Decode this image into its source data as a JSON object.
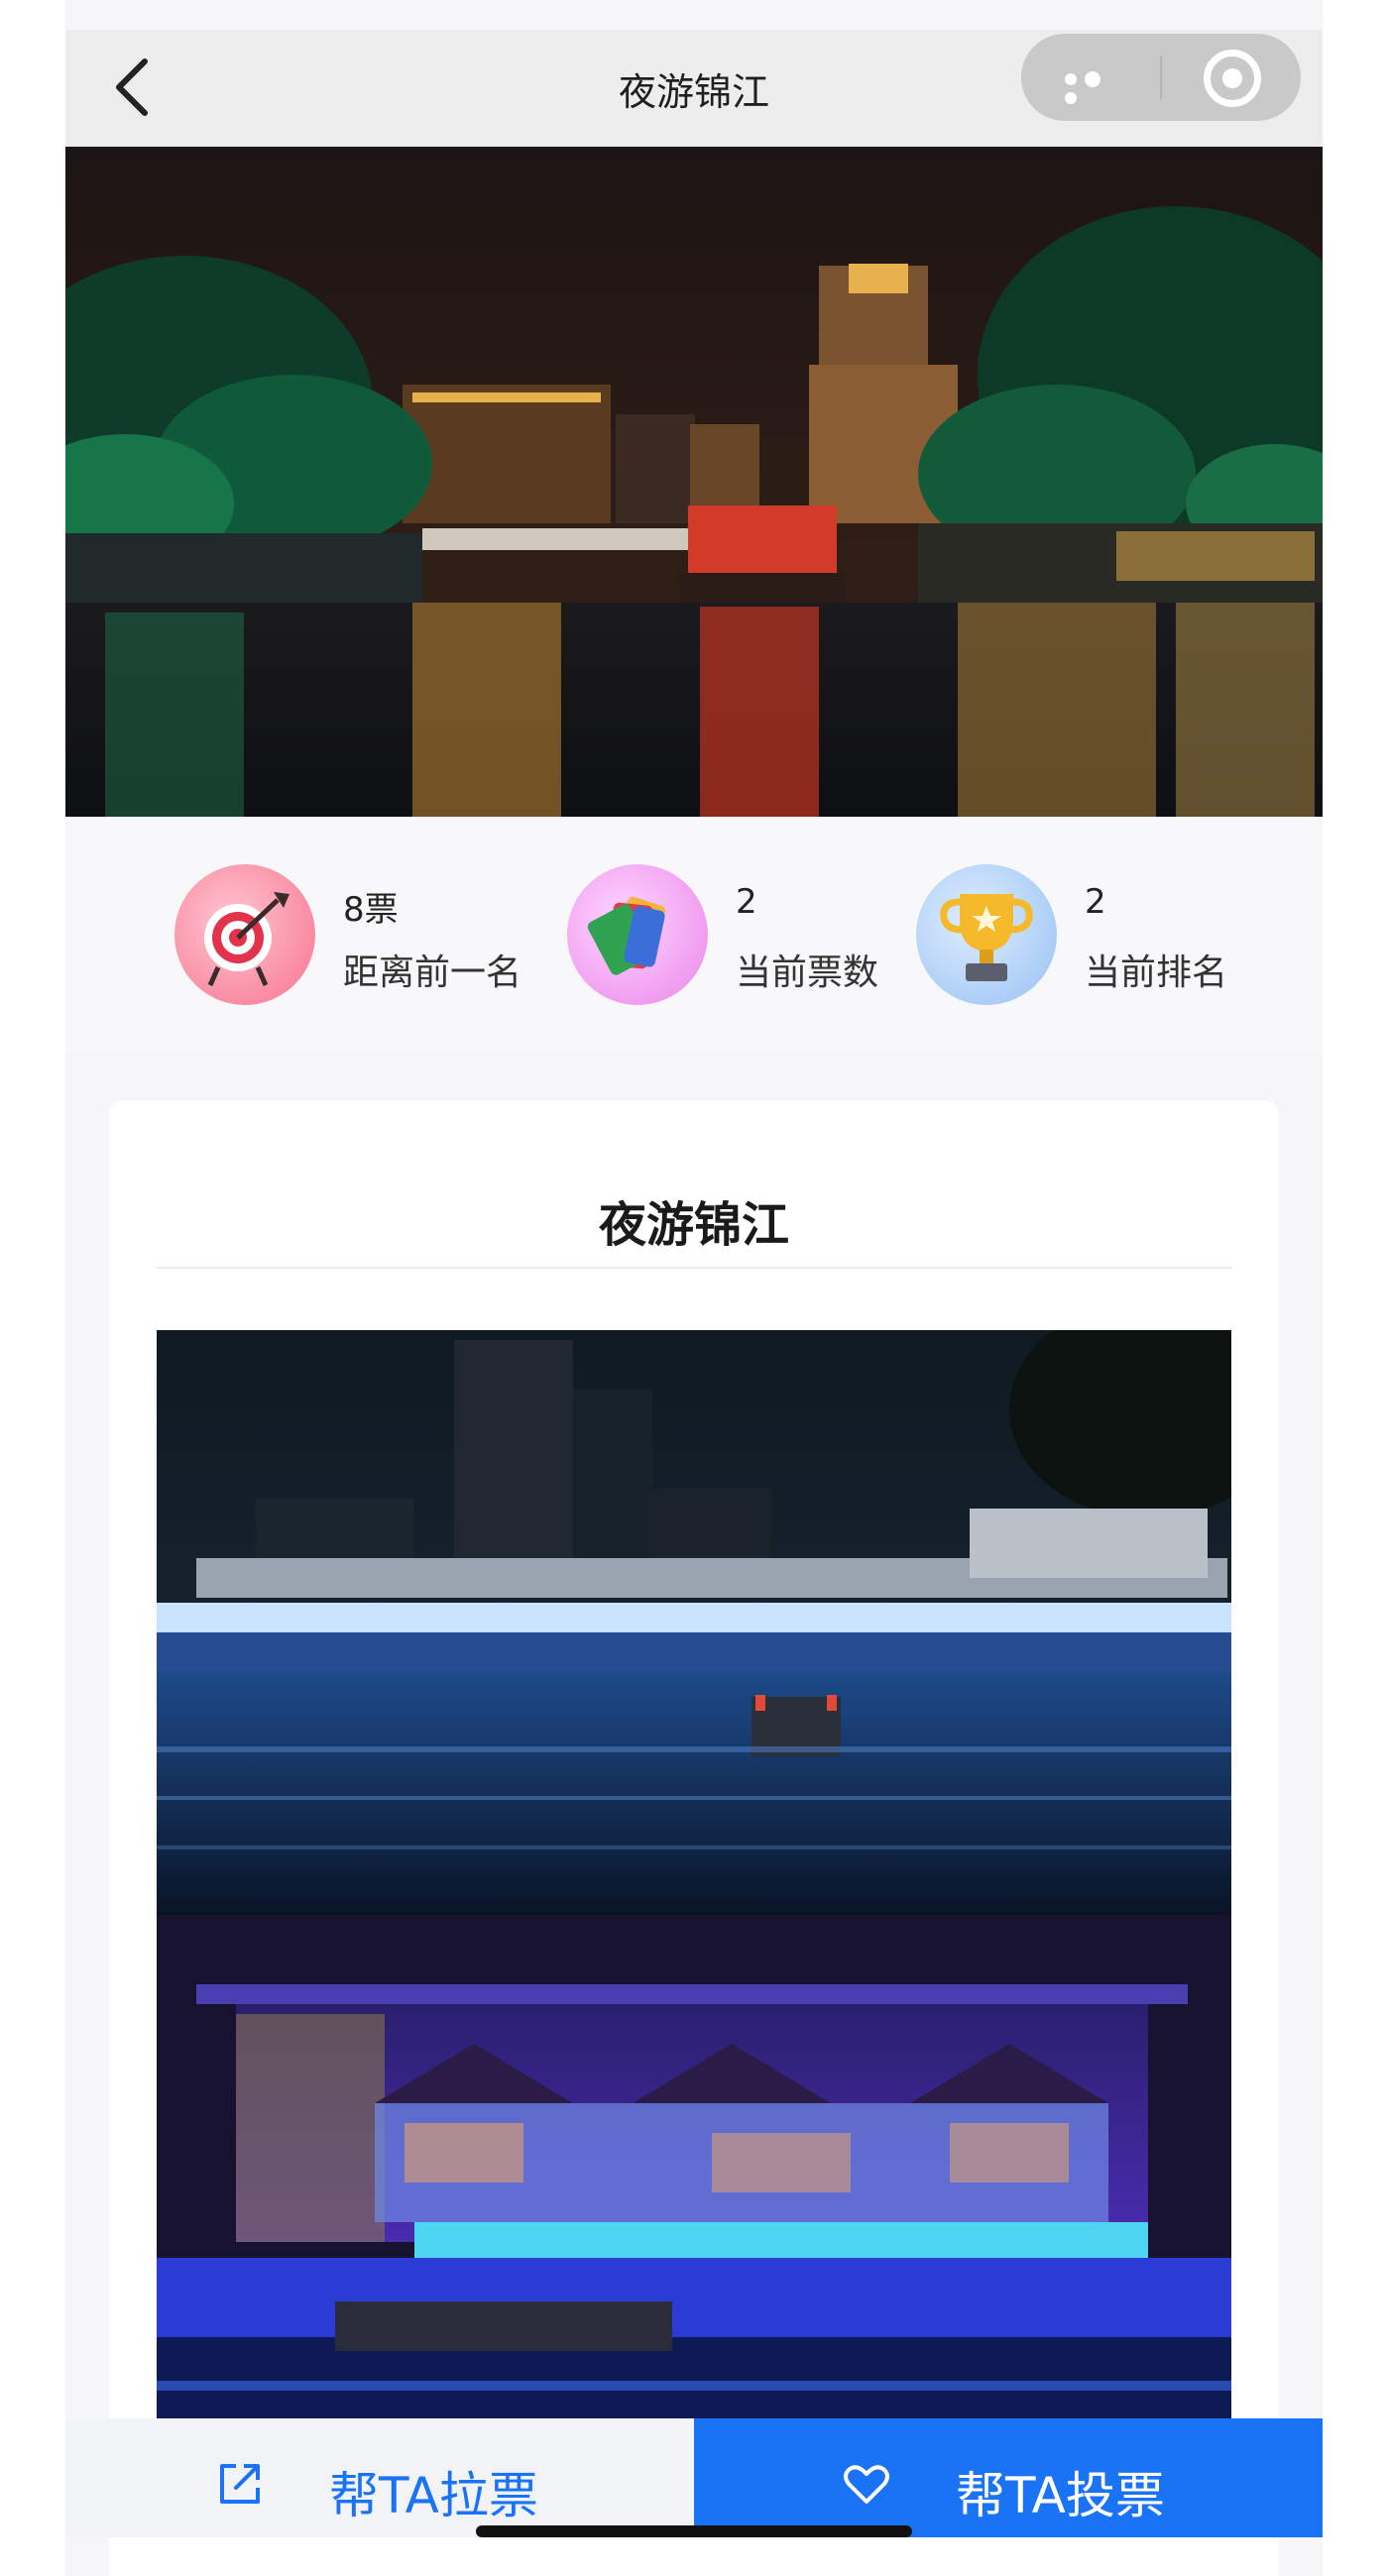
{
  "nav": {
    "title": "夜游锦江",
    "back_icon": "chevron-left-icon",
    "more_icon": "more-dots-icon",
    "close_icon": "target-circle-icon"
  },
  "stats": [
    {
      "value": "8票",
      "label": "距离前一名",
      "icon": "target-arrow-icon"
    },
    {
      "value": "2",
      "label": "当前票数",
      "icon": "tickets-icon"
    },
    {
      "value": "2",
      "label": "当前排名",
      "icon": "trophy-icon"
    }
  ],
  "entry": {
    "title": "夜游锦江"
  },
  "actions": {
    "share_label": "帮TA拉票",
    "share_icon": "share-icon",
    "vote_label": "帮TA投票",
    "vote_icon": "heart-icon"
  },
  "colors": {
    "accent": "#1a73f5",
    "nav_bg": "#ededed",
    "page_bg": "#f6f6f8"
  }
}
